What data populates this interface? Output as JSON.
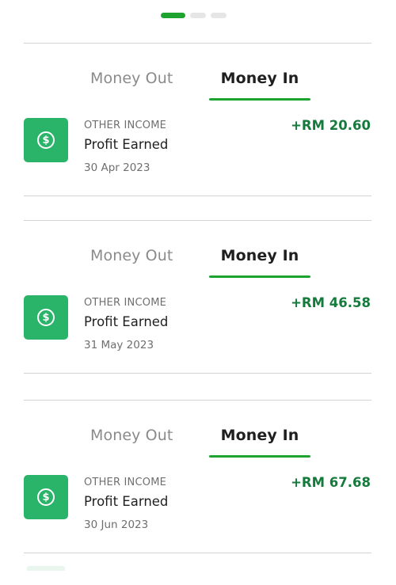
{
  "pager": {
    "count": 3,
    "active_index": 0
  },
  "colors": {
    "accent": "#1fa330",
    "icon_bg": "#29b46a",
    "amount": "#167a3d"
  },
  "sections": [
    {
      "tabs": {
        "out_label": "Money Out",
        "in_label": "Money In",
        "active": "in"
      },
      "transaction": {
        "icon": "dollar-coin-icon",
        "category": "OTHER INCOME",
        "title": "Profit Earned",
        "date": "30 Apr 2023",
        "amount": "+RM 20.60"
      }
    },
    {
      "tabs": {
        "out_label": "Money Out",
        "in_label": "Money In",
        "active": "in"
      },
      "transaction": {
        "icon": "dollar-coin-icon",
        "category": "OTHER INCOME",
        "title": "Profit Earned",
        "date": "31 May 2023",
        "amount": "+RM 46.58"
      }
    },
    {
      "tabs": {
        "out_label": "Money Out",
        "in_label": "Money In",
        "active": "in"
      },
      "transaction": {
        "icon": "dollar-coin-icon",
        "category": "OTHER INCOME",
        "title": "Profit Earned",
        "date": "30 Jun 2023",
        "amount": "+RM 67.68"
      }
    }
  ]
}
